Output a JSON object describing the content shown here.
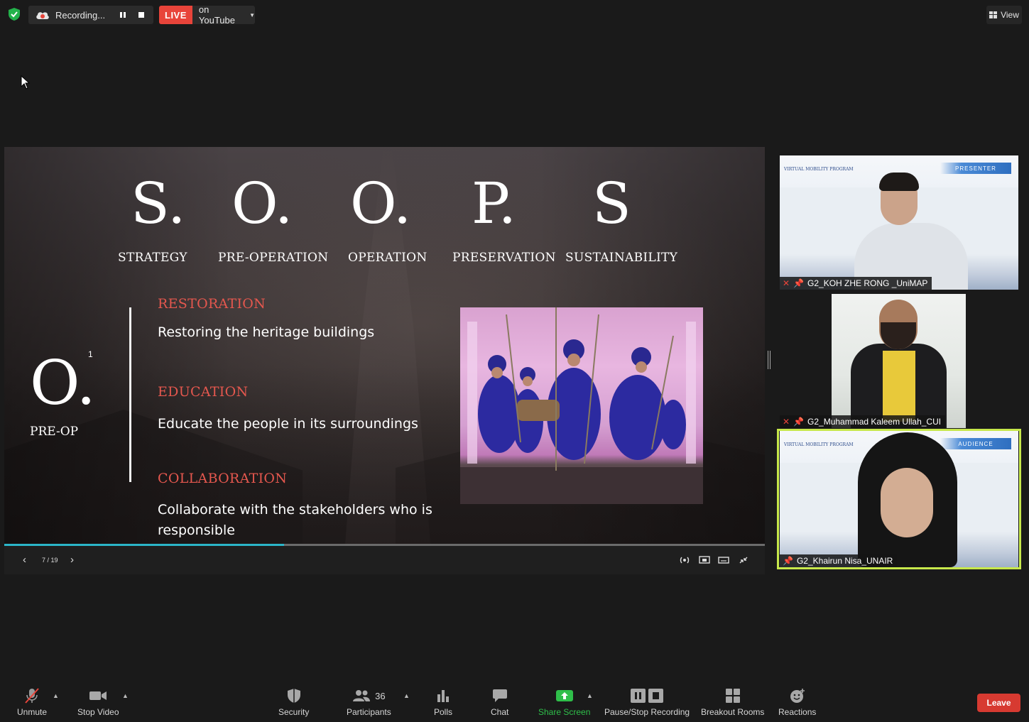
{
  "topbar": {
    "recording_label": "Recording...",
    "live_badge": "LIVE",
    "live_destination": "on YouTube",
    "view_label": "View"
  },
  "slide": {
    "letters": [
      {
        "letter": "S.",
        "word": "STRATEGY"
      },
      {
        "letter": "O.",
        "word": "PRE-OPERATION"
      },
      {
        "letter": "O.",
        "word": "OPERATION"
      },
      {
        "letter": "P.",
        "word": "PRESERVATION"
      },
      {
        "letter": "S",
        "word": "SUSTAINABILITY"
      }
    ],
    "big_letter": "O.",
    "superscript": "1",
    "subtitle": "PRE-OP",
    "sections": [
      {
        "title": "RESTORATION",
        "text": "Restoring the heritage buildings"
      },
      {
        "title": "EDUCATION",
        "text": "Educate the people in its surroundings"
      },
      {
        "title": "COLLABORATION",
        "text": "Collaborate with the stakeholders who is responsible"
      }
    ],
    "page_indicator": "7 / 19",
    "progress": 0.368
  },
  "participants_video": [
    {
      "name": "G2_KOH ZHE RONG _UniMAP",
      "tag": "PRESENTER",
      "banner": "VIRTUAL MOBILITY PROGRAM"
    },
    {
      "name": "G2_Muhammad Kaleem Ullah_CUI"
    },
    {
      "name": "G2_Khairun Nisa_UNAIR",
      "tag": "AUDIENCE",
      "banner": "VIRTUAL MOBILITY PROGRAM"
    }
  ],
  "toolbar": {
    "unmute": "Unmute",
    "stop_video": "Stop Video",
    "security": "Security",
    "participants": "Participants",
    "participants_count": "36",
    "polls": "Polls",
    "chat": "Chat",
    "share_screen": "Share Screen",
    "pause_stop_recording": "Pause/Stop Recording",
    "breakout_rooms": "Breakout Rooms",
    "reactions": "Reactions",
    "leave": "Leave"
  },
  "colors": {
    "accent_red": "#e4574e",
    "live_red": "#e8443a",
    "progress_teal": "#2bb5c8",
    "active_speaker": "#c7e84b",
    "share_green": "#2fbf4a"
  }
}
